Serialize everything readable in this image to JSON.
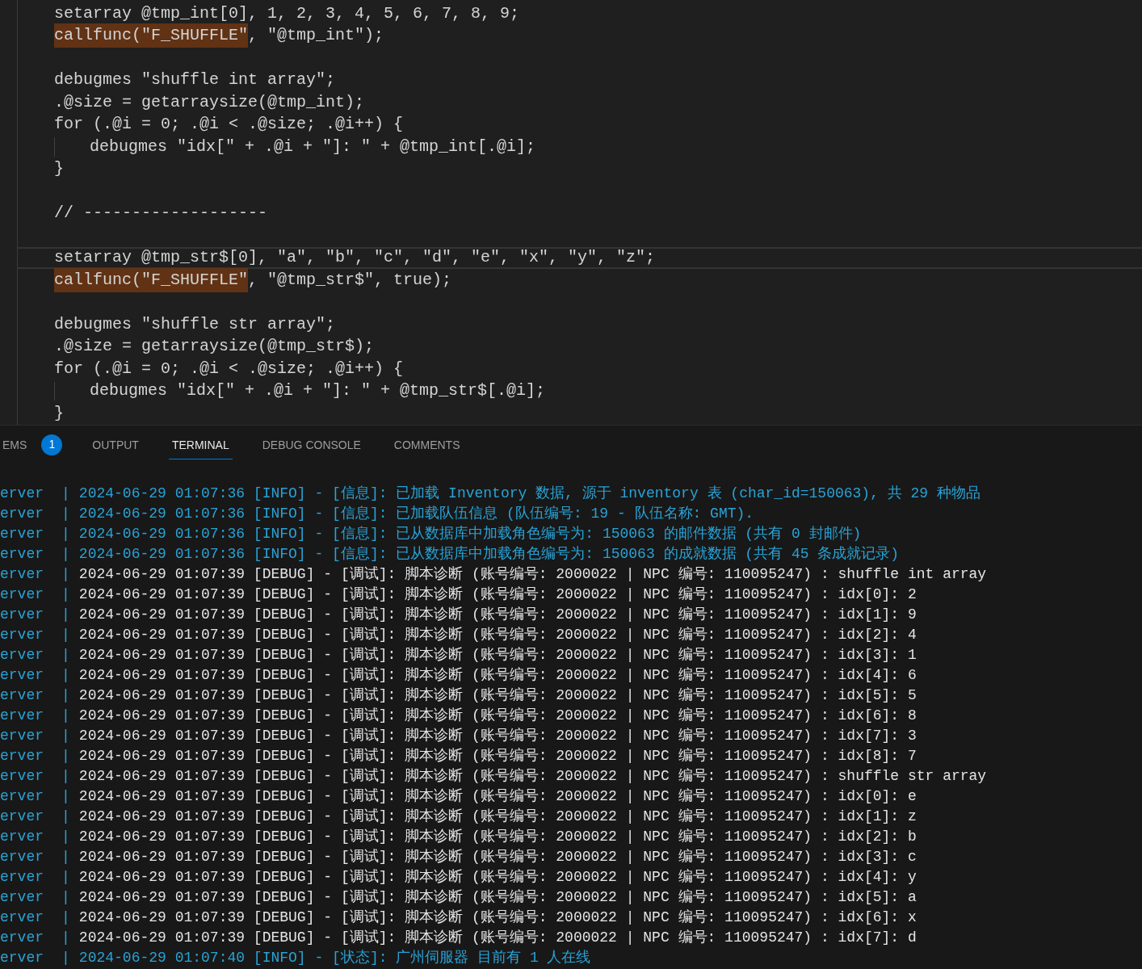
{
  "editor": {
    "lines": [
      {
        "kind": "code",
        "indented": false,
        "current": false,
        "segments": [
          {
            "text": "setarray @tmp_int[0], 1, 2, 3, 4, 5, 6, 7, 8, 9;",
            "highlighted": false
          }
        ]
      },
      {
        "kind": "code",
        "indented": false,
        "current": false,
        "segments": [
          {
            "text": "callfunc(\"F_SHUFFLE\"",
            "highlighted": true
          },
          {
            "text": ", \"@tmp_int\");",
            "highlighted": false
          }
        ]
      },
      {
        "kind": "blank"
      },
      {
        "kind": "code",
        "indented": false,
        "current": false,
        "segments": [
          {
            "text": "debugmes \"shuffle int array\";",
            "highlighted": false
          }
        ]
      },
      {
        "kind": "code",
        "indented": false,
        "current": false,
        "segments": [
          {
            "text": ".@size = getarraysize(@tmp_int);",
            "highlighted": false
          }
        ]
      },
      {
        "kind": "code",
        "indented": false,
        "current": false,
        "segments": [
          {
            "text": "for (.@i = 0; .@i < .@size; .@i++) {",
            "highlighted": false
          }
        ]
      },
      {
        "kind": "code",
        "indented": true,
        "current": false,
        "segments": [
          {
            "text": "debugmes \"idx[\" + .@i + \"]: \" + @tmp_int[.@i];",
            "highlighted": false
          }
        ]
      },
      {
        "kind": "code",
        "indented": false,
        "current": false,
        "segments": [
          {
            "text": "}",
            "highlighted": false
          }
        ]
      },
      {
        "kind": "blank"
      },
      {
        "kind": "code",
        "indented": false,
        "current": false,
        "segments": [
          {
            "text": "// -------------------",
            "highlighted": false
          }
        ]
      },
      {
        "kind": "blank"
      },
      {
        "kind": "code",
        "indented": false,
        "current": true,
        "segments": [
          {
            "text": "setarray @tmp_str$[0], \"a\", \"b\", \"c\", \"d\", \"e\", \"x\", \"y\", \"z\";",
            "highlighted": false
          }
        ]
      },
      {
        "kind": "code",
        "indented": false,
        "current": false,
        "segments": [
          {
            "text": "callfunc(\"F_SHUFFLE\"",
            "highlighted": true
          },
          {
            "text": ", \"@tmp_str$\", true);",
            "highlighted": false
          }
        ]
      },
      {
        "kind": "blank"
      },
      {
        "kind": "code",
        "indented": false,
        "current": false,
        "segments": [
          {
            "text": "debugmes \"shuffle str array\";",
            "highlighted": false
          }
        ]
      },
      {
        "kind": "code",
        "indented": false,
        "current": false,
        "segments": [
          {
            "text": ".@size = getarraysize(@tmp_str$);",
            "highlighted": false
          }
        ]
      },
      {
        "kind": "code",
        "indented": false,
        "current": false,
        "segments": [
          {
            "text": "for (.@i = 0; .@i < .@size; .@i++) {",
            "highlighted": false
          }
        ]
      },
      {
        "kind": "code",
        "indented": true,
        "current": false,
        "segments": [
          {
            "text": "debugmes \"idx[\" + .@i + \"]: \" + @tmp_str$[.@i];",
            "highlighted": false
          }
        ]
      },
      {
        "kind": "code",
        "indented": false,
        "current": false,
        "segments": [
          {
            "text": "}",
            "highlighted": false
          }
        ]
      }
    ]
  },
  "panel": {
    "tabs": [
      {
        "label": "EMS",
        "selected": false,
        "badge": "1"
      },
      {
        "label": "OUTPUT",
        "selected": false
      },
      {
        "label": "TERMINAL",
        "selected": true
      },
      {
        "label": "DEBUG CONSOLE",
        "selected": false
      },
      {
        "label": "COMMENTS",
        "selected": false
      }
    ],
    "terminal": [
      {
        "source": "erver",
        "separator": "|",
        "kind": "info",
        "text": "2024-06-29 01:07:36 [INFO] - [信息]: 已加载 Inventory 数据, 源于 inventory 表 (char_id=150063), 共 29 种物品"
      },
      {
        "source": "erver",
        "separator": "|",
        "kind": "info",
        "text": "2024-06-29 01:07:36 [INFO] - [信息]: 已加载队伍信息 (队伍编号: 19 - 队伍名称: GMT)."
      },
      {
        "source": "erver",
        "separator": "|",
        "kind": "info",
        "text": "2024-06-29 01:07:36 [INFO] - [信息]: 已从数据库中加载角色编号为: 150063 的邮件数据 (共有 0 封邮件)"
      },
      {
        "source": "erver",
        "separator": "|",
        "kind": "info",
        "text": "2024-06-29 01:07:36 [INFO] - [信息]: 已从数据库中加载角色编号为: 150063 的成就数据 (共有 45 条成就记录)"
      },
      {
        "source": "erver",
        "separator": "|",
        "kind": "debug",
        "text": "2024-06-29 01:07:39 [DEBUG] - [调试]: 脚本诊断 (账号编号: 2000022 | NPC 编号: 110095247) : shuffle int array"
      },
      {
        "source": "erver",
        "separator": "|",
        "kind": "debug",
        "text": "2024-06-29 01:07:39 [DEBUG] - [调试]: 脚本诊断 (账号编号: 2000022 | NPC 编号: 110095247) : idx[0]: 2"
      },
      {
        "source": "erver",
        "separator": "|",
        "kind": "debug",
        "text": "2024-06-29 01:07:39 [DEBUG] - [调试]: 脚本诊断 (账号编号: 2000022 | NPC 编号: 110095247) : idx[1]: 9"
      },
      {
        "source": "erver",
        "separator": "|",
        "kind": "debug",
        "text": "2024-06-29 01:07:39 [DEBUG] - [调试]: 脚本诊断 (账号编号: 2000022 | NPC 编号: 110095247) : idx[2]: 4"
      },
      {
        "source": "erver",
        "separator": "|",
        "kind": "debug",
        "text": "2024-06-29 01:07:39 [DEBUG] - [调试]: 脚本诊断 (账号编号: 2000022 | NPC 编号: 110095247) : idx[3]: 1"
      },
      {
        "source": "erver",
        "separator": "|",
        "kind": "debug",
        "text": "2024-06-29 01:07:39 [DEBUG] - [调试]: 脚本诊断 (账号编号: 2000022 | NPC 编号: 110095247) : idx[4]: 6"
      },
      {
        "source": "erver",
        "separator": "|",
        "kind": "debug",
        "text": "2024-06-29 01:07:39 [DEBUG] - [调试]: 脚本诊断 (账号编号: 2000022 | NPC 编号: 110095247) : idx[5]: 5"
      },
      {
        "source": "erver",
        "separator": "|",
        "kind": "debug",
        "text": "2024-06-29 01:07:39 [DEBUG] - [调试]: 脚本诊断 (账号编号: 2000022 | NPC 编号: 110095247) : idx[6]: 8"
      },
      {
        "source": "erver",
        "separator": "|",
        "kind": "debug",
        "text": "2024-06-29 01:07:39 [DEBUG] - [调试]: 脚本诊断 (账号编号: 2000022 | NPC 编号: 110095247) : idx[7]: 3"
      },
      {
        "source": "erver",
        "separator": "|",
        "kind": "debug",
        "text": "2024-06-29 01:07:39 [DEBUG] - [调试]: 脚本诊断 (账号编号: 2000022 | NPC 编号: 110095247) : idx[8]: 7"
      },
      {
        "source": "erver",
        "separator": "|",
        "kind": "debug",
        "text": "2024-06-29 01:07:39 [DEBUG] - [调试]: 脚本诊断 (账号编号: 2000022 | NPC 编号: 110095247) : shuffle str array"
      },
      {
        "source": "erver",
        "separator": "|",
        "kind": "debug",
        "text": "2024-06-29 01:07:39 [DEBUG] - [调试]: 脚本诊断 (账号编号: 2000022 | NPC 编号: 110095247) : idx[0]: e"
      },
      {
        "source": "erver",
        "separator": "|",
        "kind": "debug",
        "text": "2024-06-29 01:07:39 [DEBUG] - [调试]: 脚本诊断 (账号编号: 2000022 | NPC 编号: 110095247) : idx[1]: z"
      },
      {
        "source": "erver",
        "separator": "|",
        "kind": "debug",
        "text": "2024-06-29 01:07:39 [DEBUG] - [调试]: 脚本诊断 (账号编号: 2000022 | NPC 编号: 110095247) : idx[2]: b"
      },
      {
        "source": "erver",
        "separator": "|",
        "kind": "debug",
        "text": "2024-06-29 01:07:39 [DEBUG] - [调试]: 脚本诊断 (账号编号: 2000022 | NPC 编号: 110095247) : idx[3]: c"
      },
      {
        "source": "erver",
        "separator": "|",
        "kind": "debug",
        "text": "2024-06-29 01:07:39 [DEBUG] - [调试]: 脚本诊断 (账号编号: 2000022 | NPC 编号: 110095247) : idx[4]: y"
      },
      {
        "source": "erver",
        "separator": "|",
        "kind": "debug",
        "text": "2024-06-29 01:07:39 [DEBUG] - [调试]: 脚本诊断 (账号编号: 2000022 | NPC 编号: 110095247) : idx[5]: a"
      },
      {
        "source": "erver",
        "separator": "|",
        "kind": "debug",
        "text": "2024-06-29 01:07:39 [DEBUG] - [调试]: 脚本诊断 (账号编号: 2000022 | NPC 编号: 110095247) : idx[6]: x"
      },
      {
        "source": "erver",
        "separator": "|",
        "kind": "debug",
        "text": "2024-06-29 01:07:39 [DEBUG] - [调试]: 脚本诊断 (账号编号: 2000022 | NPC 编号: 110095247) : idx[7]: d"
      },
      {
        "source": "erver",
        "separator": "|",
        "kind": "info",
        "text": "2024-06-29 01:07:40 [INFO] - [状态]: 广州伺服器 目前有 1 人在线"
      }
    ]
  }
}
